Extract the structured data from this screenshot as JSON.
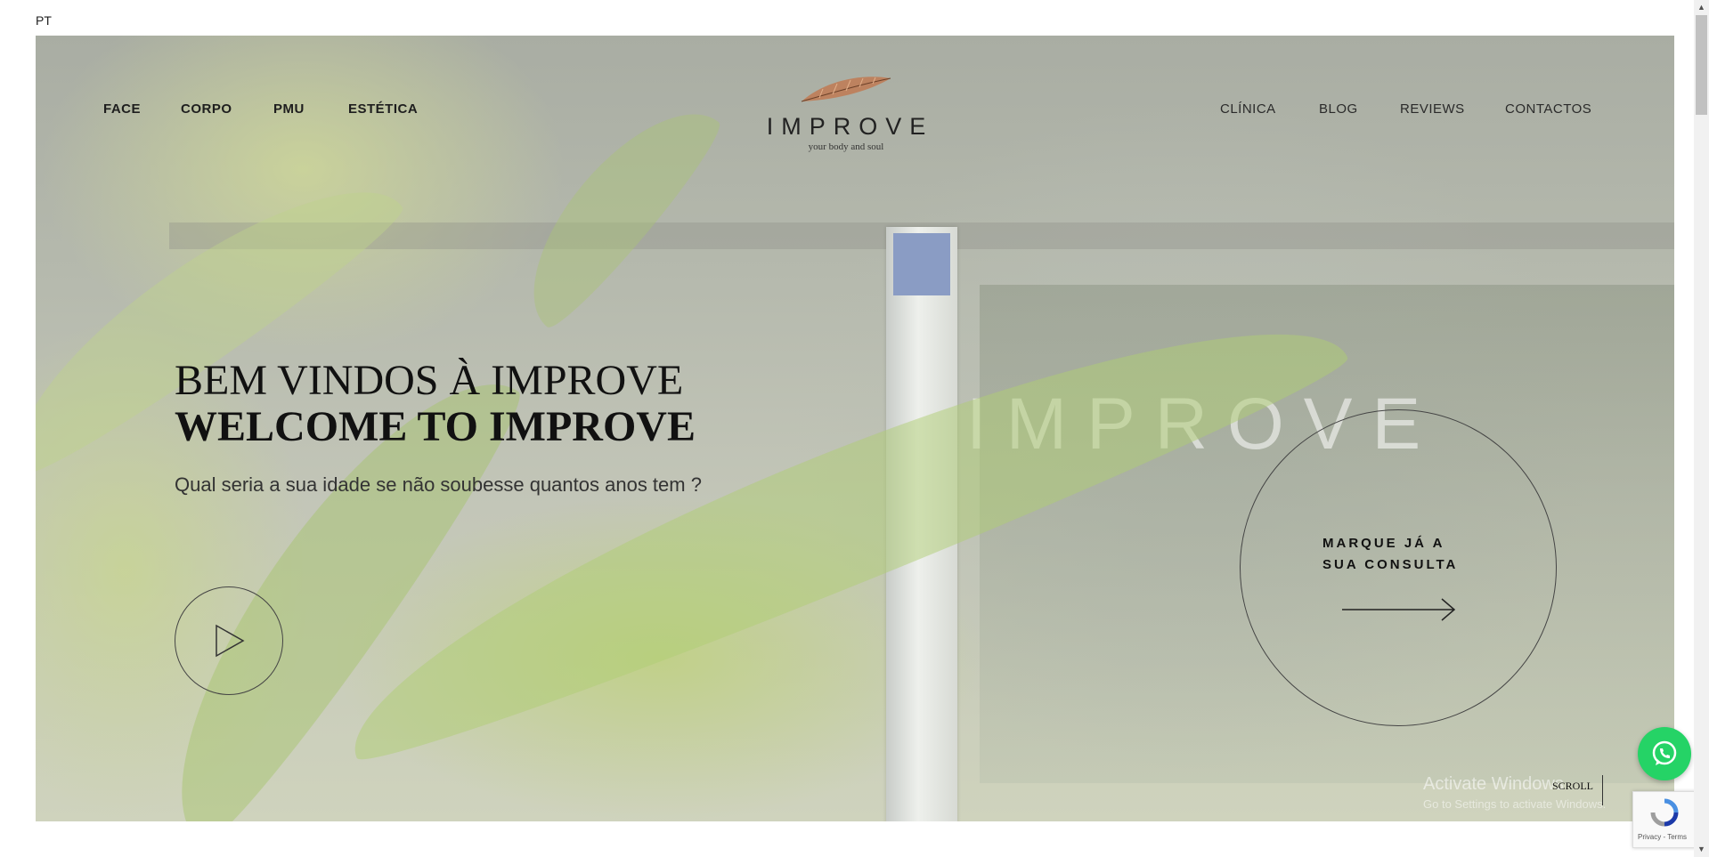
{
  "language": "PT",
  "nav_left": [
    "FACE",
    "CORPO",
    "PMU",
    "ESTÉTICA"
  ],
  "nav_right": [
    "CLÍNICA",
    "BLOG",
    "REVIEWS",
    "CONTACTOS"
  ],
  "logo": {
    "word": "IMPROVE",
    "tagline": "your body and soul"
  },
  "background_sign": "IMPROVE",
  "hero": {
    "title_line1": "BEM VINDOS À IMPROVE",
    "title_line2": "WELCOME TO IMPROVE",
    "subtitle": "Qual seria a sua idade se não soubesse quantos anos tem ?"
  },
  "cta": {
    "line1": "MARQUE JÁ A",
    "line2": "SUA CONSULTA"
  },
  "scroll_label": "SCROLL",
  "windows_watermark": {
    "line1": "Activate Windows",
    "line2": "Go to Settings to activate Windows."
  },
  "recaptcha": {
    "privacy": "Privacy",
    "separator": " - ",
    "terms": "Terms"
  },
  "icons": {
    "play": "play-icon",
    "arrow": "arrow-right-icon",
    "whatsapp": "whatsapp-icon",
    "recaptcha": "recaptcha-icon"
  },
  "colors": {
    "whatsapp": "#25d366",
    "feather": "#b8734a"
  }
}
